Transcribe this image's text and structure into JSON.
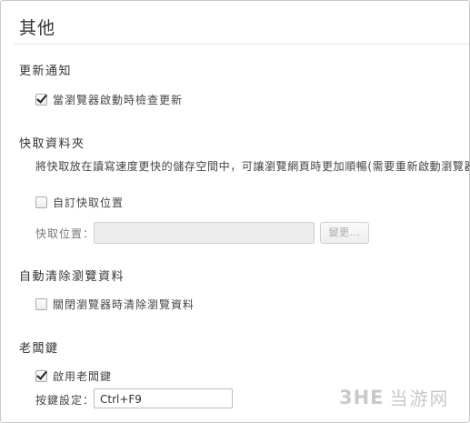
{
  "page": {
    "title": "其他"
  },
  "updates": {
    "title": "更新通知",
    "check_on_start": {
      "label": "當瀏覽器啟動時檢查更新",
      "checked": true
    }
  },
  "cache": {
    "title": "快取資料夾",
    "description": "將快取放在讀寫速度更快的儲存空間中，可讓瀏覽網頁時更加順暢(需要重新啟動瀏覽器)",
    "custom_location": {
      "label": "自訂快取位置",
      "checked": false
    },
    "location_label": "快取位置：",
    "location_value": "",
    "change_button": "變更..."
  },
  "auto_clear": {
    "title": "自動清除瀏覽資料",
    "clear_on_close": {
      "label": "關閉瀏覽器時清除瀏覽資料",
      "checked": false
    }
  },
  "boss_key": {
    "title": "老闆鍵",
    "enable": {
      "label": "啟用老闆鍵",
      "checked": true
    },
    "hotkey_label": "按鍵設定：",
    "hotkey_value": "Ctrl+F9"
  },
  "watermark": {
    "logo": "3HE",
    "text": "当游网"
  }
}
